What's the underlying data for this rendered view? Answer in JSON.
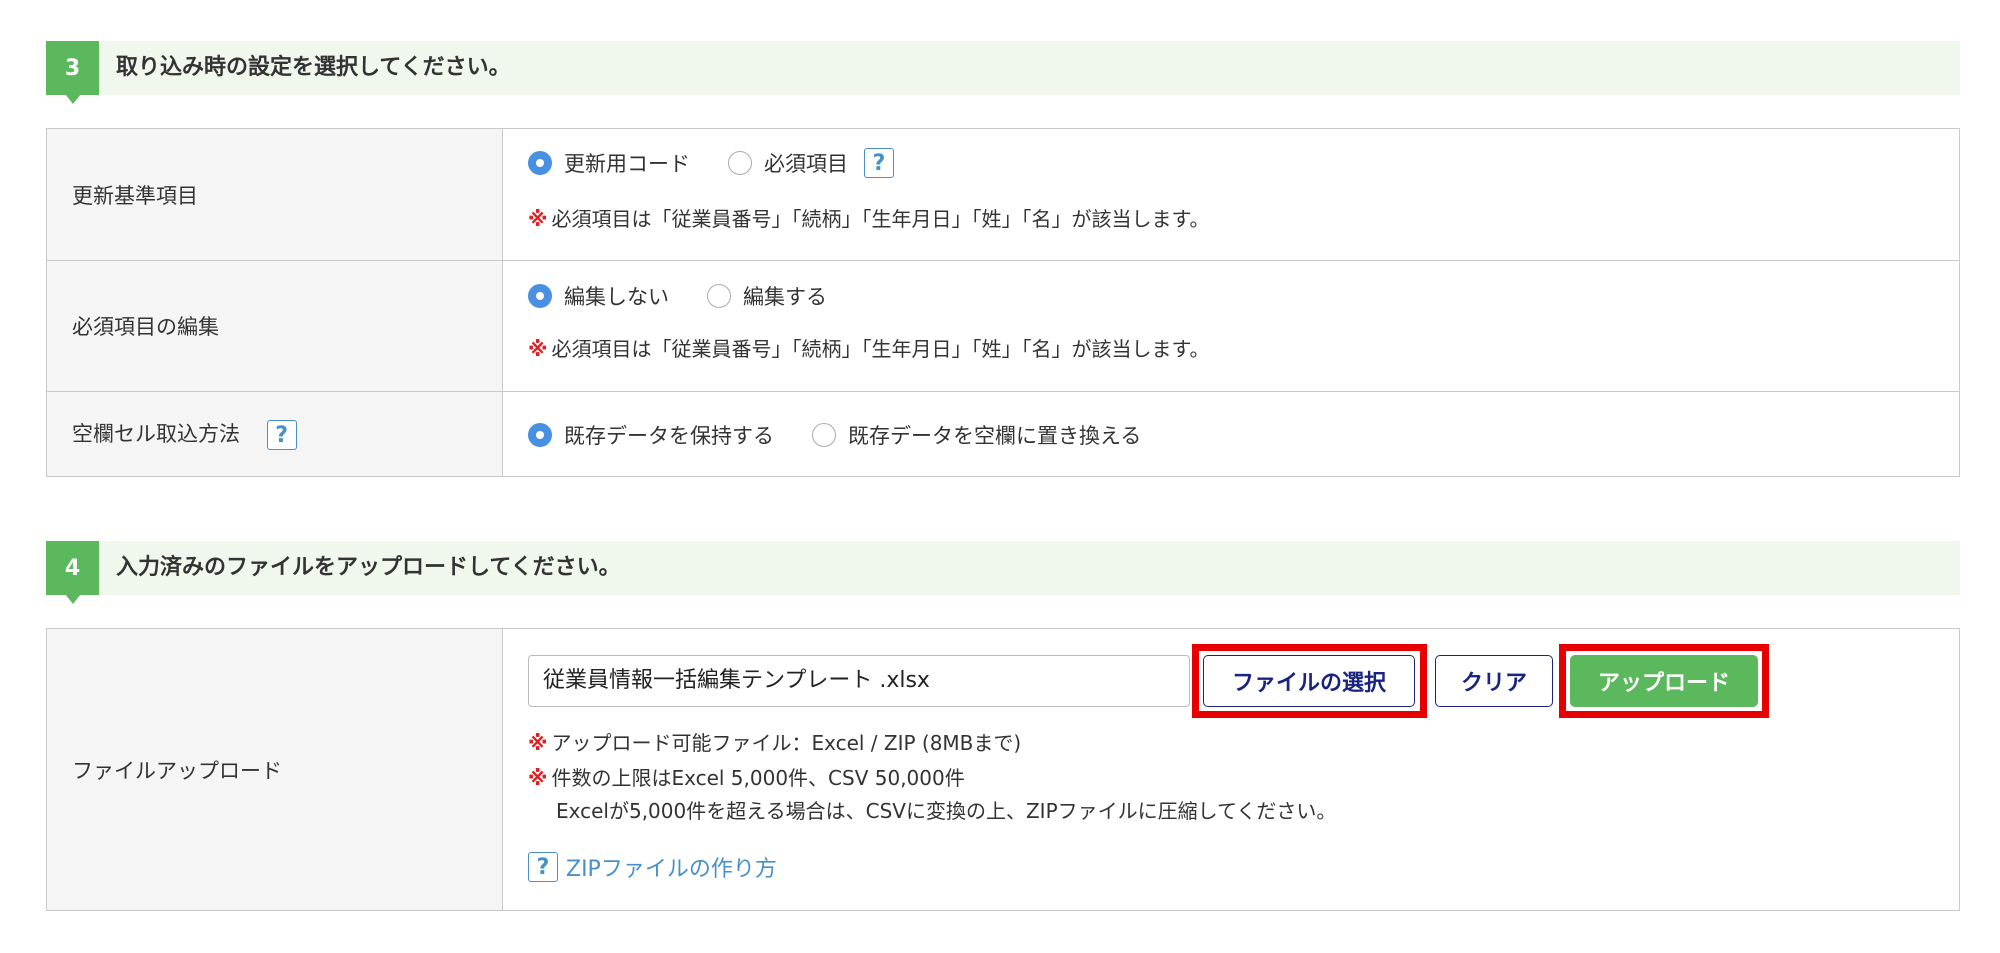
{
  "section3": {
    "number": "3",
    "title": "取り込み時の設定を選択してください。",
    "rows": [
      {
        "label": "更新基準項目",
        "options": [
          "更新用コード",
          "必須項目"
        ],
        "selected": 0,
        "help": "?",
        "note_mark": "※",
        "note": "必須項目は「従業員番号」「続柄」「生年月日」「姓」「名」が該当します。"
      },
      {
        "label": "必須項目の編集",
        "options": [
          "編集しない",
          "編集する"
        ],
        "selected": 0,
        "note_mark": "※",
        "note": "必須項目は「従業員番号」「続柄」「生年月日」「姓」「名」が該当します。"
      },
      {
        "label": "空欄セル取込方法",
        "label_help": "?",
        "options": [
          "既存データを保持する",
          "既存データを空欄に置き換える"
        ],
        "selected": 0
      }
    ]
  },
  "section4": {
    "number": "4",
    "title": "入力済みのファイルをアップロードしてください。",
    "row": {
      "label": "ファイルアップロード",
      "file_name": "従業員情報一括編集テンプレート .xlsx",
      "choose_button": "ファイルの選択",
      "clear_button": "クリア",
      "upload_button": "アップロード",
      "note_mark": "※",
      "notes": [
        "アップロード可能ファイル：Excel / ZIP (8MBまで)",
        "件数の上限はExcel 5,000件、CSV 50,000件"
      ],
      "note_continuation": "Excelが5,000件を超える場合は、CSVに変換の上、ZIPファイルに圧縮してください。",
      "help": "?",
      "zip_link": "ZIPファイルの作り方"
    }
  },
  "colors": {
    "accent_green": "#5cb85c",
    "section_bg": "#f0f8ee",
    "highlight_red": "#e60000",
    "radio_blue": "#4a90e2",
    "navy": "#1a237e"
  }
}
